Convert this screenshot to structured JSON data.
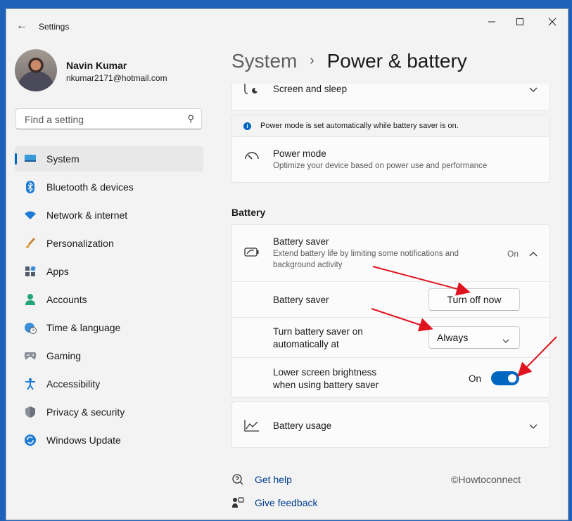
{
  "window": {
    "title": "Settings",
    "minimize_icon": "minimize-icon",
    "maximize_icon": "maximize-icon",
    "close_icon": "close-icon"
  },
  "user": {
    "name": "Navin Kumar",
    "email": "nkumar2171@hotmail.com"
  },
  "search": {
    "placeholder": "Find a setting"
  },
  "nav": {
    "items": [
      {
        "label": "System",
        "icon": "system-icon"
      },
      {
        "label": "Bluetooth & devices",
        "icon": "bluetooth-icon"
      },
      {
        "label": "Network & internet",
        "icon": "wifi-icon"
      },
      {
        "label": "Personalization",
        "icon": "brush-icon"
      },
      {
        "label": "Apps",
        "icon": "apps-icon"
      },
      {
        "label": "Accounts",
        "icon": "person-icon"
      },
      {
        "label": "Time & language",
        "icon": "globe-clock-icon"
      },
      {
        "label": "Gaming",
        "icon": "controller-icon"
      },
      {
        "label": "Accessibility",
        "icon": "accessibility-icon"
      },
      {
        "label": "Privacy & security",
        "icon": "shield-icon"
      },
      {
        "label": "Windows Update",
        "icon": "update-icon"
      }
    ]
  },
  "header": {
    "parent": "System",
    "separator": "›",
    "title": "Power & battery"
  },
  "screen_sleep": {
    "title": "Screen and sleep"
  },
  "power_mode": {
    "info": "Power mode is set automatically while battery saver is on.",
    "title": "Power mode",
    "description": "Optimize your device based on power use and performance"
  },
  "battery_section": {
    "label": "Battery"
  },
  "battery_saver": {
    "title": "Battery saver",
    "description_line1": "Extend battery life by limiting some notifications and",
    "description_line2": "background activity",
    "status": "On",
    "row_label": "Battery saver",
    "turn_off_button": "Turn off now",
    "auto_label_line1": "Turn battery saver on",
    "auto_label_line2": "automatically at",
    "auto_value": "Always",
    "brightness_label_line1": "Lower screen brightness",
    "brightness_label_line2": "when using battery saver",
    "brightness_status": "On",
    "brightness_on": true
  },
  "battery_usage": {
    "title": "Battery usage"
  },
  "footer": {
    "help": "Get help",
    "feedback": "Give feedback",
    "watermark": "©Howtoconnect"
  },
  "colors": {
    "accent": "#0067c0",
    "annotation_arrow": "#e0141e"
  }
}
